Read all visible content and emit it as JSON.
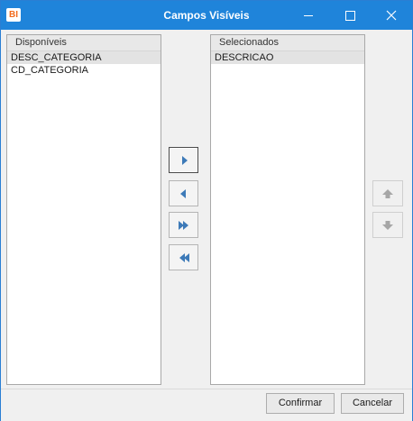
{
  "window": {
    "title": "Campos Visíveis",
    "app_icon_text": "BI"
  },
  "available": {
    "header": "Disponíveis",
    "items": [
      {
        "label": "DESC_CATEGORIA",
        "selected": true
      },
      {
        "label": "CD_CATEGORIA",
        "selected": false
      }
    ]
  },
  "selected": {
    "header": "Selecionados",
    "items": [
      {
        "label": "DESCRICAO",
        "selected": true
      }
    ]
  },
  "transfer_buttons": [
    {
      "icon": "arrow-right-icon",
      "enabled": true
    },
    {
      "icon": "arrow-left-icon",
      "enabled": true
    },
    {
      "icon": "double-arrow-right-icon",
      "enabled": true
    },
    {
      "icon": "double-arrow-left-icon",
      "enabled": true
    }
  ],
  "order_buttons": [
    {
      "icon": "arrow-up-icon",
      "enabled": false
    },
    {
      "icon": "arrow-down-icon",
      "enabled": false
    }
  ],
  "footer": {
    "confirm_label": "Confirmar",
    "cancel_label": "Cancelar"
  },
  "colors": {
    "titlebar": "#1f84da",
    "arrow": "#3d7ab8",
    "disabled_arrow": "#a6a6a6",
    "app_icon": "#f26b1d"
  }
}
